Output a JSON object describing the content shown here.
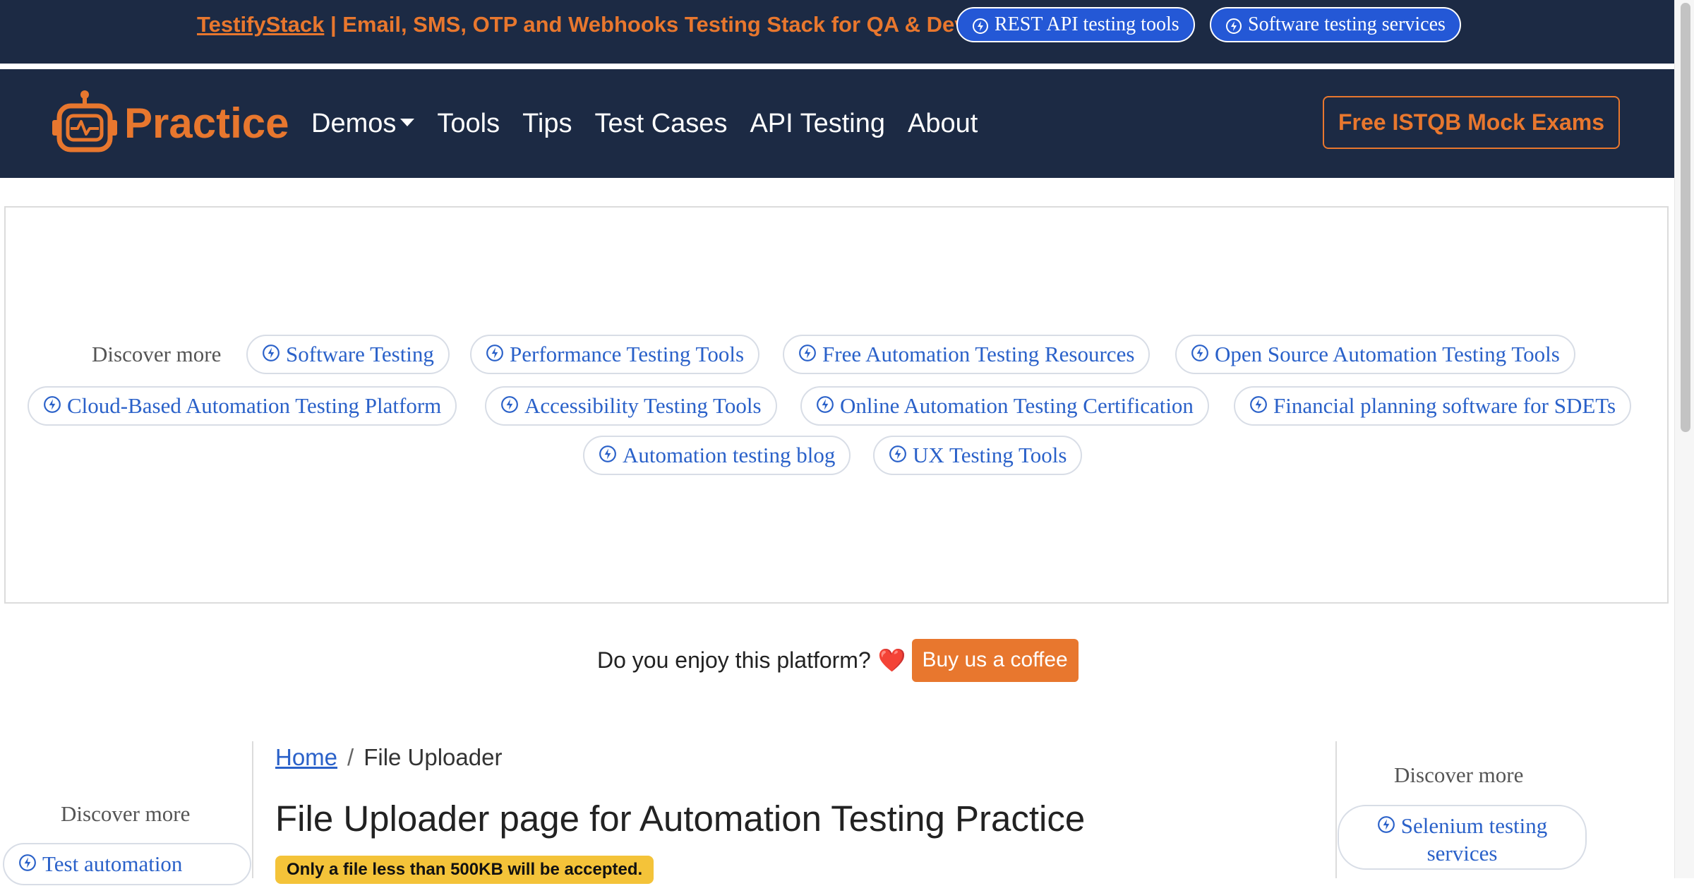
{
  "promo_bar": {
    "brand_link": "TestifyStack",
    "tagline": " | Email, SMS, OTP and Webhooks Testing Stack for QA & Dev",
    "pills": [
      "REST API testing tools",
      "Software testing services"
    ]
  },
  "navbar": {
    "brand": "Practice",
    "links": [
      "Demos",
      "Tools",
      "Tips",
      "Test Cases",
      "API Testing",
      "About"
    ],
    "cta": "Free ISTQB Mock Exams"
  },
  "discover": {
    "label": "Discover more",
    "chips": [
      "Software Testing",
      "Performance Testing Tools",
      "Free Automation Testing Resources",
      "Open Source Automation Testing Tools",
      "Cloud-Based Automation Testing Platform",
      "Accessibility Testing Tools",
      "Online Automation Testing Certification",
      "Financial planning software for SDETs",
      "Automation testing blog",
      "UX Testing Tools"
    ]
  },
  "enjoy": {
    "text": "Do you enjoy this platform?",
    "heart": "❤️",
    "button": "Buy us a coffee"
  },
  "left_sidebar": {
    "label": "Discover more",
    "chip": "Test automation"
  },
  "main": {
    "breadcrumb_home": "Home",
    "breadcrumb_current": "File Uploader",
    "title": "File Uploader page for Automation Testing Practice",
    "notice": "Only a file less than 500KB will be accepted."
  },
  "right_sidebar": {
    "label": "Discover more",
    "chip_line1": "Selenium testing",
    "chip_line2": "services"
  },
  "colors": {
    "navy": "#1c2a44",
    "orange": "#e8772e",
    "link_blue": "#2a61c9",
    "pill_blue": "#2458d6",
    "badge_yellow": "#f4c339"
  }
}
